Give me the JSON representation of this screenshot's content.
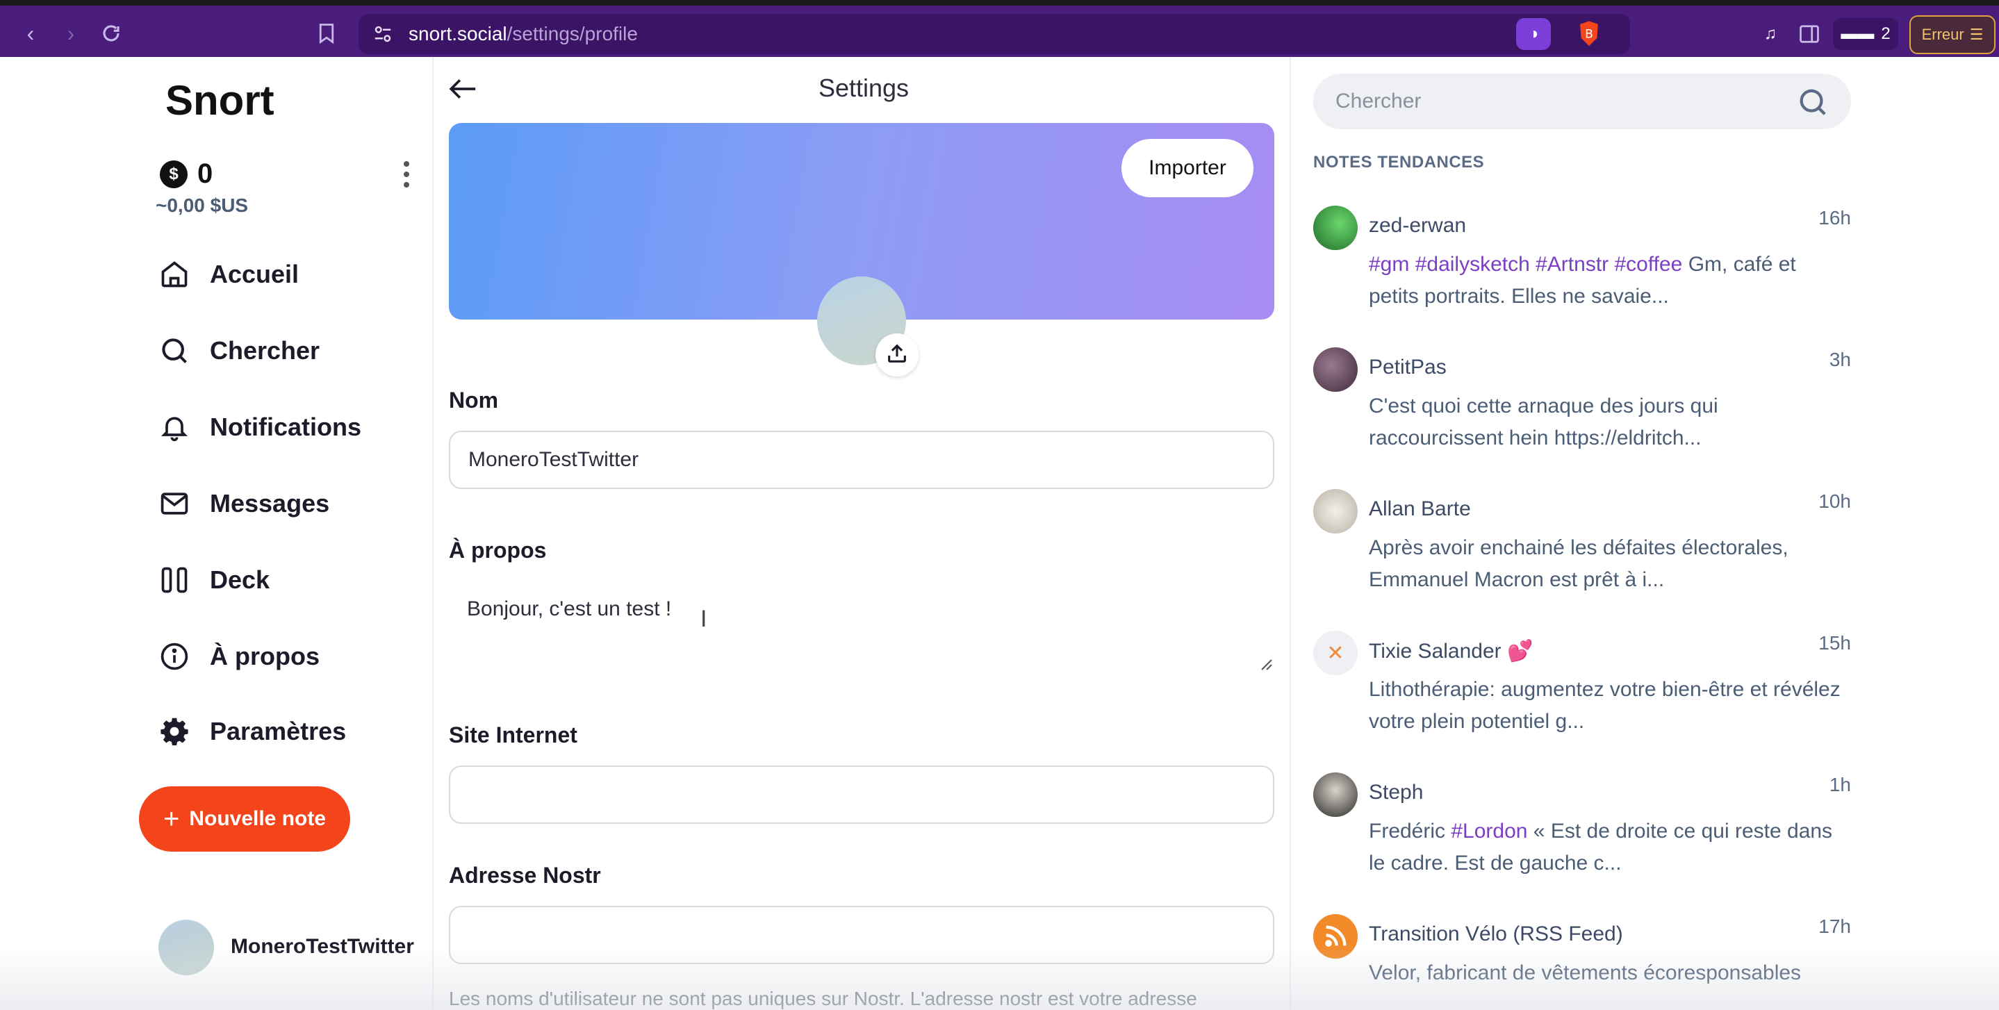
{
  "browser": {
    "url_host": "snort.social",
    "url_path": "/settings/profile",
    "shields_count": "2",
    "vpn_count": "2",
    "error_label": "Erreur"
  },
  "sidebar": {
    "logo": "Snort",
    "balance": "0",
    "balance_fiat": "~0,00 $US",
    "items": [
      {
        "label": "Accueil",
        "icon": "home-icon"
      },
      {
        "label": "Chercher",
        "icon": "search-icon"
      },
      {
        "label": "Notifications",
        "icon": "bell-icon"
      },
      {
        "label": "Messages",
        "icon": "mail-icon"
      },
      {
        "label": "Deck",
        "icon": "columns-icon"
      },
      {
        "label": "À propos",
        "icon": "info-icon"
      },
      {
        "label": "Paramètres",
        "icon": "gear-icon"
      }
    ],
    "new_note_label": "Nouvelle note",
    "username": "MoneroTestTwitter"
  },
  "settings": {
    "title": "Settings",
    "import_label": "Importer",
    "name_label": "Nom",
    "name_value": "MoneroTestTwitter",
    "about_label": "À propos",
    "about_value": "Bonjour, c'est un test !",
    "website_label": "Site Internet",
    "website_value": "",
    "nostr_label": "Adresse Nostr",
    "nostr_value": "",
    "help_text": "Les noms d'utilisateur ne sont pas uniques sur Nostr. L'adresse nostr est votre adresse"
  },
  "right": {
    "search_placeholder": "Chercher",
    "trending_title": "NOTES TENDANCES",
    "notes": [
      {
        "author": "zed-erwan",
        "time": "16h",
        "tags": "#gm #dailysketch #Artnstr #coffee",
        "text": " Gm, café et petits portraits. Elles ne savaie..."
      },
      {
        "author": "PetitPas",
        "time": "3h",
        "tags": "",
        "text": "C'est quoi cette arnaque des jours qui raccourcissent hein https://eldritch..."
      },
      {
        "author": "Allan Barte",
        "time": "10h",
        "tags": "",
        "text": "Après avoir enchainé les défaites électorales, Emmanuel Macron est prêt à i..."
      },
      {
        "author": "Tixie Salander 💕",
        "time": "15h",
        "tags": "",
        "text": "Lithothérapie: augmentez votre bien-être et révélez votre plein potentiel g..."
      },
      {
        "author": "Steph",
        "time": "1h",
        "text_before": "Fredéric ",
        "tags": "#Lordon",
        "text": " « Est de droite ce qui reste dans le cadre. Est de gauche c..."
      },
      {
        "author": "Transition Vélo (RSS Feed)",
        "time": "17h",
        "tags": "",
        "text": "Velor, fabricant de vêtements écoresponsables"
      }
    ]
  },
  "colors": {
    "accent": "#f4441b",
    "chrome": "#4a1c7c",
    "hashtag": "#7b3fc4"
  }
}
